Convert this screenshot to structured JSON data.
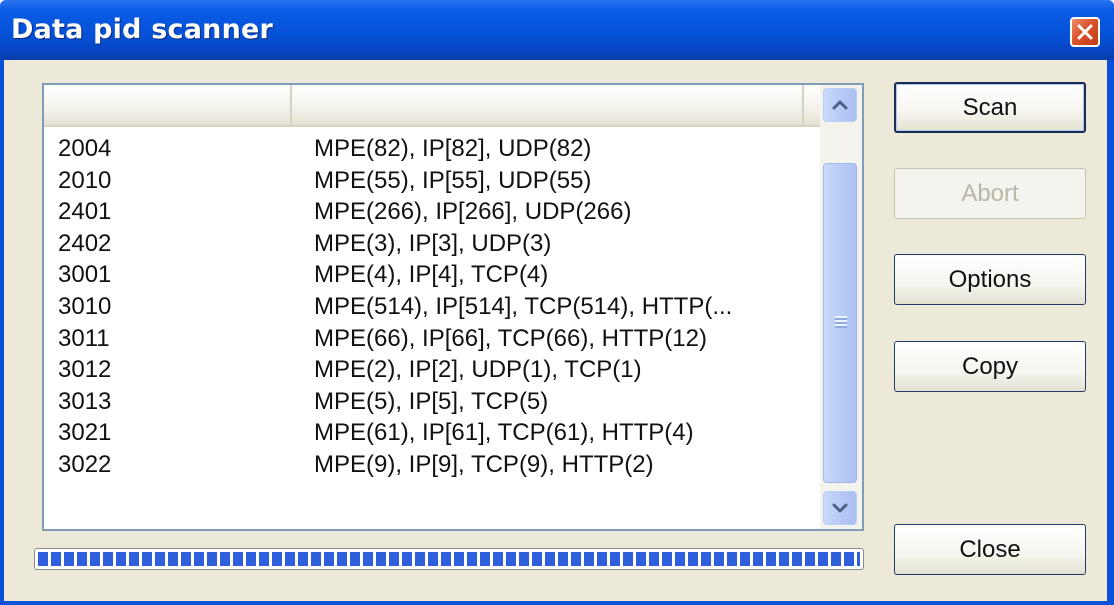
{
  "window": {
    "title": "Data pid scanner"
  },
  "list": {
    "columns": [
      "",
      ""
    ],
    "rows": [
      {
        "pid": "2004",
        "protocols": "MPE(82), IP[82], UDP(82)"
      },
      {
        "pid": "2010",
        "protocols": "MPE(55), IP[55], UDP(55)"
      },
      {
        "pid": "2401",
        "protocols": "MPE(266), IP[266], UDP(266)"
      },
      {
        "pid": "2402",
        "protocols": "MPE(3), IP[3], UDP(3)"
      },
      {
        "pid": "3001",
        "protocols": "MPE(4), IP[4], TCP(4)"
      },
      {
        "pid": "3010",
        "protocols": "MPE(514), IP[514], TCP(514), HTTP(..."
      },
      {
        "pid": "3011",
        "protocols": "MPE(66), IP[66], TCP(66), HTTP(12)"
      },
      {
        "pid": "3012",
        "protocols": "MPE(2), IP[2], UDP(1), TCP(1)"
      },
      {
        "pid": "3013",
        "protocols": "MPE(5), IP[5], TCP(5)"
      },
      {
        "pid": "3021",
        "protocols": "MPE(61), IP[61], TCP(61), HTTP(4)"
      },
      {
        "pid": "3022",
        "protocols": "MPE(9), IP[9], TCP(9), HTTP(2)"
      }
    ]
  },
  "progress": {
    "fraction": 1.0,
    "color": "#2f5fdc"
  },
  "buttons": {
    "scan": "Scan",
    "abort": "Abort",
    "options": "Options",
    "copy": "Copy",
    "close": "Close"
  },
  "icons": {
    "close": "close-x-icon",
    "scroll_up": "chevron-up-icon",
    "scroll_down": "chevron-down-icon",
    "scroll_grip": "grip-icon"
  },
  "colors": {
    "titlebar": "#0552d8",
    "dialog_bg": "#ece9d8",
    "close_button": "#d9542c",
    "scrollbar": "#b9cdf6"
  }
}
